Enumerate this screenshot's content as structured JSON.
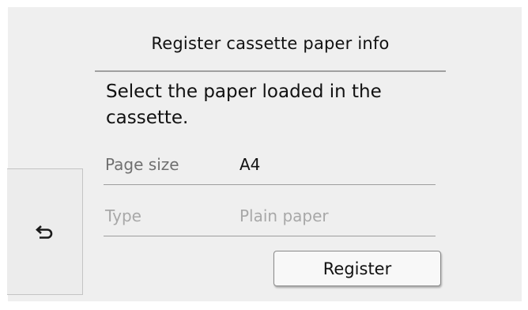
{
  "header": {
    "title": "Register cassette paper info"
  },
  "message": {
    "line1": "Select the paper loaded in the",
    "line2": "cassette."
  },
  "settings": [
    {
      "label": "Page size",
      "value": "A4",
      "enabled": true
    },
    {
      "label": "Type",
      "value": "Plain paper",
      "enabled": false
    }
  ],
  "actions": {
    "register_label": "Register",
    "back_icon": "back-arrow-icon"
  },
  "colors": {
    "background": "#efefef",
    "divider": "#a0a0a0",
    "label_text": "#707070",
    "disabled_text": "#a8a8a8"
  }
}
